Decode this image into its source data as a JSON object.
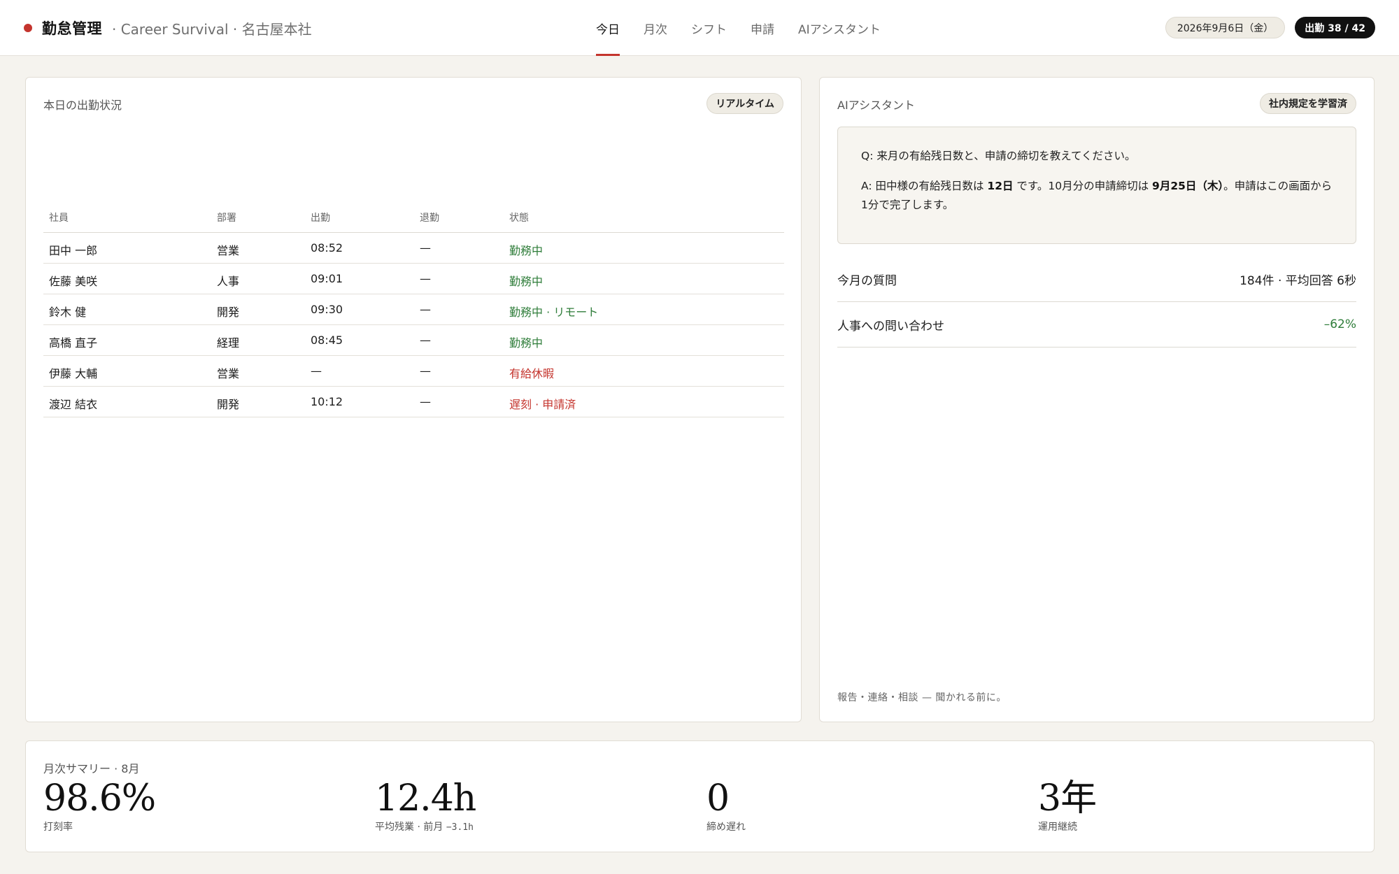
{
  "header": {
    "title": "勤怠管理",
    "subtitle": "· Career Survival · 名古屋本社",
    "tabs": [
      {
        "label": "今日",
        "active": true
      },
      {
        "label": "月次",
        "active": false
      },
      {
        "label": "シフト",
        "active": false
      },
      {
        "label": "申請",
        "active": false
      },
      {
        "label": "AIアシスタント",
        "active": false
      }
    ],
    "date": "2026年9月6日（金）",
    "attendance_badge": "出勤 38 / 42",
    "accent_color": "#c4342d"
  },
  "attendance": {
    "title": "本日の出勤状況",
    "badge": "リアルタイム",
    "columns": [
      "社員",
      "部署",
      "出勤",
      "退勤",
      "状態"
    ],
    "rows": [
      {
        "name": "田中 一郎",
        "dept": "営業",
        "in": "08:52",
        "out": "—",
        "status": "勤務中",
        "status_type": "ok"
      },
      {
        "name": "佐藤 美咲",
        "dept": "人事",
        "in": "09:01",
        "out": "—",
        "status": "勤務中",
        "status_type": "ok"
      },
      {
        "name": "鈴木 健",
        "dept": "開発",
        "in": "09:30",
        "out": "—",
        "status": "勤務中 · リモート",
        "status_type": "ok"
      },
      {
        "name": "高橋 直子",
        "dept": "経理",
        "in": "08:45",
        "out": "—",
        "status": "勤務中",
        "status_type": "ok"
      },
      {
        "name": "伊藤 大輔",
        "dept": "営業",
        "in": "—",
        "out": "—",
        "status": "有給休暇",
        "status_type": "ng"
      },
      {
        "name": "渡辺 結衣",
        "dept": "開発",
        "in": "10:12",
        "out": "—",
        "status": "遅刻 · 申請済",
        "status_type": "ng"
      }
    ]
  },
  "assistant": {
    "title": "AIアシスタント",
    "badge": "社内規定を学習済",
    "question": "Q:  来月の有給残日数と、申請の締切を教えてください。",
    "answer": {
      "p1": "A:  田中様の有給残日数は ",
      "b1": "12日",
      "p2": " です。10月分の申請締切は ",
      "b2": "9月25日（木）",
      "p3": "。申請はこの画面から1分で完了します。"
    },
    "metrics": [
      {
        "label": "今月の質問",
        "value": "184件 · 平均回答 6秒",
        "positive": false
      },
      {
        "label": "人事への問い合わせ",
        "value": "–62%",
        "positive": true
      }
    ],
    "footer": "報告・連絡・相談 — 聞かれる前に。"
  },
  "summary": {
    "title": "月次サマリー · 8月",
    "stats": [
      {
        "value": "98.6%",
        "label": "打刻率",
        "note": ""
      },
      {
        "value": "12.4h",
        "label": "平均残業 · 前月 ",
        "note": "−3.1h"
      },
      {
        "value": "0",
        "label": "締め遅れ",
        "note": ""
      },
      {
        "value": "3年",
        "label": "運用継続",
        "note": ""
      }
    ]
  }
}
